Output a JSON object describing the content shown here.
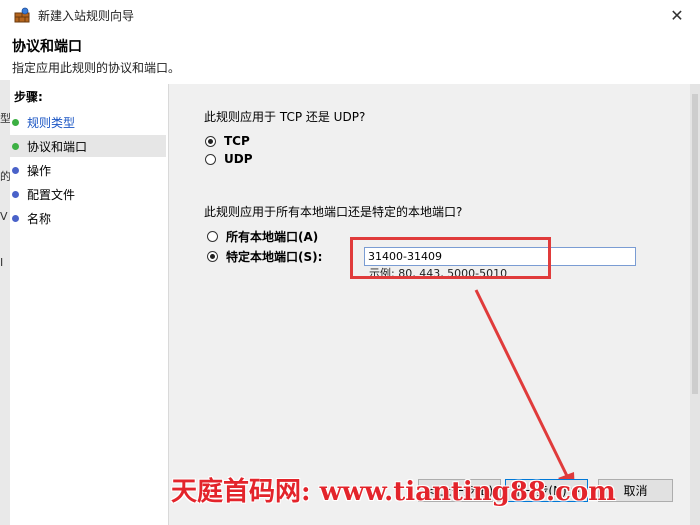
{
  "window": {
    "title": "新建入站规则向导"
  },
  "header": {
    "title": "协议和端口",
    "subtitle": "指定应用此规则的协议和端口。"
  },
  "left_edge_fragments": [
    "型",
    "的",
    "V",
    "I"
  ],
  "steps": {
    "label": "步骤:",
    "items": [
      {
        "label": "规则类型",
        "color": "#3cb043",
        "link": true,
        "active": false
      },
      {
        "label": "协议和端口",
        "color": "#3cb043",
        "link": false,
        "active": true
      },
      {
        "label": "操作",
        "color": "#4a62c9",
        "link": false,
        "active": false
      },
      {
        "label": "配置文件",
        "color": "#4a62c9",
        "link": false,
        "active": false
      },
      {
        "label": "名称",
        "color": "#4a62c9",
        "link": false,
        "active": false
      }
    ]
  },
  "protocol": {
    "question": "此规则应用于 TCP 还是 UDP?",
    "options": [
      {
        "label": "TCP",
        "checked": true
      },
      {
        "label": "UDP",
        "checked": false
      }
    ]
  },
  "ports": {
    "question": "此规则应用于所有本地端口还是特定的本地端口?",
    "options": [
      {
        "label": "所有本地端口(A)",
        "checked": false
      },
      {
        "label": "特定本地端口(S):",
        "checked": true
      }
    ],
    "value": "31400-31409",
    "example": "示例: 80, 443, 5000-5010"
  },
  "buttons": {
    "back": "< 上一步(B)",
    "next": "下一步(N) >",
    "cancel": "取消"
  },
  "watermark": "天庭首码网: www.tianting88.com",
  "colors": {
    "annotation": "#e03b3b",
    "link": "#1a55c4"
  }
}
